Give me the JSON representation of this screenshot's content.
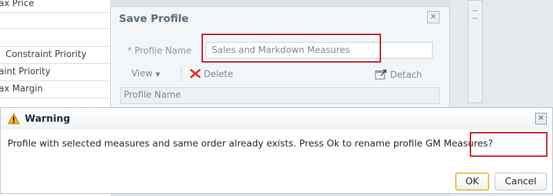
{
  "background": {
    "list_items": [
      "ax Price",
      "Constraint Priority",
      "aint Priority",
      "ax Margin"
    ]
  },
  "save_dialog": {
    "title": "Save Profile",
    "profile_name_label": "* Profile Name",
    "profile_name_value": "Sales and Markdown Measures",
    "view_label": "View",
    "delete_label": "Delete",
    "detach_label": "Detach",
    "column_header": "Profile Name"
  },
  "warning_dialog": {
    "title": "Warning",
    "message_prefix": "Profile with selected measures and same order already exists. Press Ok to rename profile ",
    "message_highlight": "GM Measures?",
    "ok_label": "OK",
    "cancel_label": "Cancel"
  },
  "colors": {
    "highlight_border": "#c4161c",
    "warning_icon": "#f2b51c",
    "delete_icon": "#d9322c"
  }
}
